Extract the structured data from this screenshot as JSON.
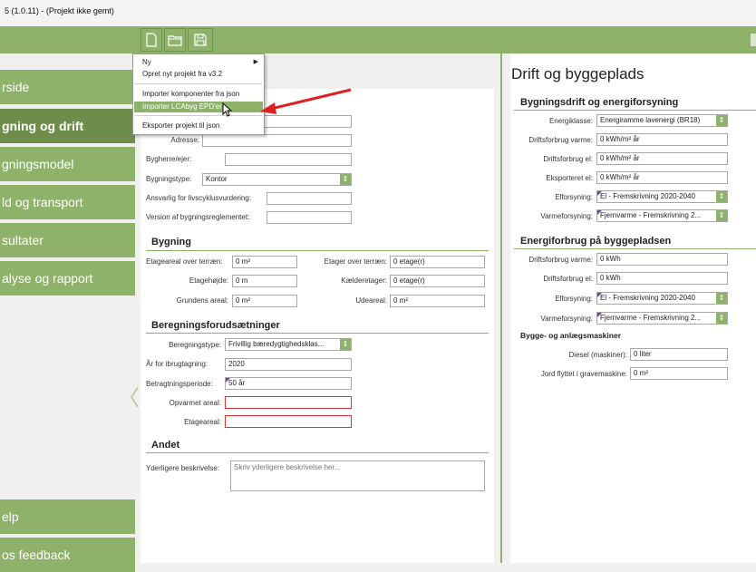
{
  "window": {
    "title": "5 (1.0.11) - (Projekt ikke gemt)"
  },
  "sidebar": {
    "items": [
      {
        "label": "rside"
      },
      {
        "label": "gning og drift"
      },
      {
        "label": "gningsmodel"
      },
      {
        "label": "ld og transport"
      },
      {
        "label": "sultater"
      },
      {
        "label": "alyse og rapport"
      }
    ],
    "bottom_items": [
      {
        "label": "elp"
      },
      {
        "label": "os feedback"
      }
    ],
    "collapse_glyph": "〈"
  },
  "menu": {
    "items": [
      {
        "label": "Ny",
        "submenu_glyph": "▶"
      },
      {
        "label": "Opret nyt projekt fra v3.2"
      },
      {
        "label": "Importer komponenter fra json"
      },
      {
        "label": "Importer LCAbyg EPD'er"
      },
      {
        "label": "Eksporter projekt til json"
      }
    ]
  },
  "main": {
    "general": {
      "address_label": "Adresse:",
      "address_value": "",
      "owner_label": "Bygherre/ejer:",
      "owner_value": "",
      "type_label": "Bygningstype:",
      "type_value": "Kontor",
      "responsible_label": "Ansvarlig for livscyklusvurdering:",
      "responsible_value": "",
      "regulation_label": "Version af bygningsreglementet:",
      "regulation_value": ""
    },
    "building": {
      "title": "Bygning",
      "floor_area_label": "Etageareal over terræn:",
      "floor_area_value": "0 m²",
      "floors_above_label": "Etager over terræn:",
      "floors_above_value": "0 etage(r)",
      "floor_height_label": "Etagehøjde:",
      "floor_height_value": "0 m",
      "basements_label": "Kælderetager:",
      "basements_value": "0 etage(r)",
      "ground_area_label": "Grundens areal:",
      "ground_area_value": "0 m²",
      "outdoor_area_label": "Udeareal:",
      "outdoor_area_value": "0 m²"
    },
    "assumptions": {
      "title": "Beregningsforudsætninger",
      "calc_type_label": "Beregningstype:",
      "calc_type_value": "Frivillig bæredygtighedsklas...",
      "year_label": "År for ibrugtagning:",
      "year_value": "2020",
      "period_label": "Betragtningsperiode:",
      "period_value": "50 år",
      "heated_area_label": "Opvarmet areal:",
      "heated_area_value": "",
      "floor_area_label": "Etageareal:",
      "floor_area_value": ""
    },
    "other": {
      "title": "Andet",
      "description_label": "Yderligere beskrivelse:",
      "description_placeholder": "Skriv yderligere beskrivelse her..."
    }
  },
  "right": {
    "title": "Drift og byggeplads",
    "operation": {
      "title": "Bygningsdrift og energiforsyning",
      "energy_class_label": "Energiklasse:",
      "energy_class_value": "Energiramme lavenergi (BR18)",
      "heat_use_label": "Driftsforbrug varme:",
      "heat_use_value": "0 kWh/m² år",
      "el_use_label": "Driftsforbrug el:",
      "el_use_value": "0 kWh/m² år",
      "exported_el_label": "Eksporteret el:",
      "exported_el_value": "0 kWh/m² år",
      "el_supply_label": "Elforsyning:",
      "el_supply_value": "El - Fremskrivning 2020-2040",
      "heat_supply_label": "Varmeforsyning:",
      "heat_supply_value": "Fjernvarme - Fremskrivning 2..."
    },
    "site": {
      "title": "Energiforbrug på byggepladsen",
      "heat_use_label": "Driftsforbrug varme:",
      "heat_use_value": "0 kWh",
      "el_use_label": "Driftsforbrug el:",
      "el_use_value": "0 kWh",
      "el_supply_label": "Elforsyning:",
      "el_supply_value": "El - Fremskrivning 2020-2040",
      "heat_supply_label": "Varmeforsyning:",
      "heat_supply_value": "Fjernvarme - Fremskrivning 2..."
    },
    "machines": {
      "title": "Bygge- og anlægsmaskiner",
      "diesel_label": "Diesel (maskiner):",
      "diesel_value": "0 liter",
      "soil_label": "Jord flyttet i gravemaskine:",
      "soil_value": "0 m²"
    }
  },
  "colors": {
    "accent": "#8fb26a",
    "accent_dark": "#6e8d4b",
    "error": "#dd3333",
    "arrow": "#e02020"
  }
}
